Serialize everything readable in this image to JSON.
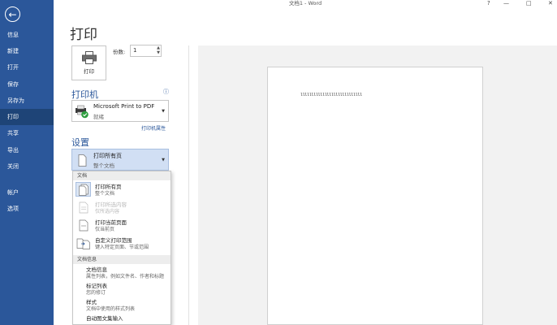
{
  "titlebar": {
    "title": "文档1 - Word",
    "help": "?",
    "minimize": "—",
    "restore": "□",
    "close": "✕"
  },
  "sidebar": {
    "back_icon": "←",
    "items": [
      {
        "label": "信息"
      },
      {
        "label": "新建"
      },
      {
        "label": "打开"
      },
      {
        "label": "保存"
      },
      {
        "label": "另存为"
      },
      {
        "label": "打印",
        "active": true
      },
      {
        "label": "共享"
      },
      {
        "label": "导出"
      },
      {
        "label": "关闭"
      },
      {
        "label": "帐户"
      },
      {
        "label": "选项"
      }
    ]
  },
  "main": {
    "heading": "打印",
    "print_button": "打印",
    "copies_label": "份数:",
    "copies_value": "1",
    "printer_heading": "打印机",
    "printer_name": "Microsoft Print to PDF",
    "printer_status": "就绪",
    "printer_props": "打印机属性",
    "info_icon": "ⓘ",
    "settings_heading": "设置",
    "settings_title": "打印所有页",
    "settings_desc": "整个文档"
  },
  "dropdown": {
    "section1": "文档",
    "items": [
      {
        "title": "打印所有页",
        "desc": "整个文档",
        "selected": true
      },
      {
        "title": "打印所选内容",
        "desc": "仅所选内容",
        "disabled": true
      },
      {
        "title": "打印当前页面",
        "desc": "仅当前页"
      },
      {
        "title": "自定义打印范围",
        "desc": "键入特定页面、节或范围"
      }
    ],
    "section2": "文档信息",
    "info": [
      {
        "title": "文档信息",
        "desc": "属性列表，例如文件名、作者和标题"
      },
      {
        "title": "标记列表",
        "desc": "您的修订"
      },
      {
        "title": "样式",
        "desc": "文档中使用的样式列表"
      },
      {
        "title": "自动图文集输入",
        "desc": ""
      }
    ]
  },
  "preview": {
    "text": "llllllllllllllllllllllllllll"
  },
  "colors": {
    "sidebar": "#2b579a",
    "sidebar_active": "#1e4477",
    "accent": "#2b579a"
  }
}
